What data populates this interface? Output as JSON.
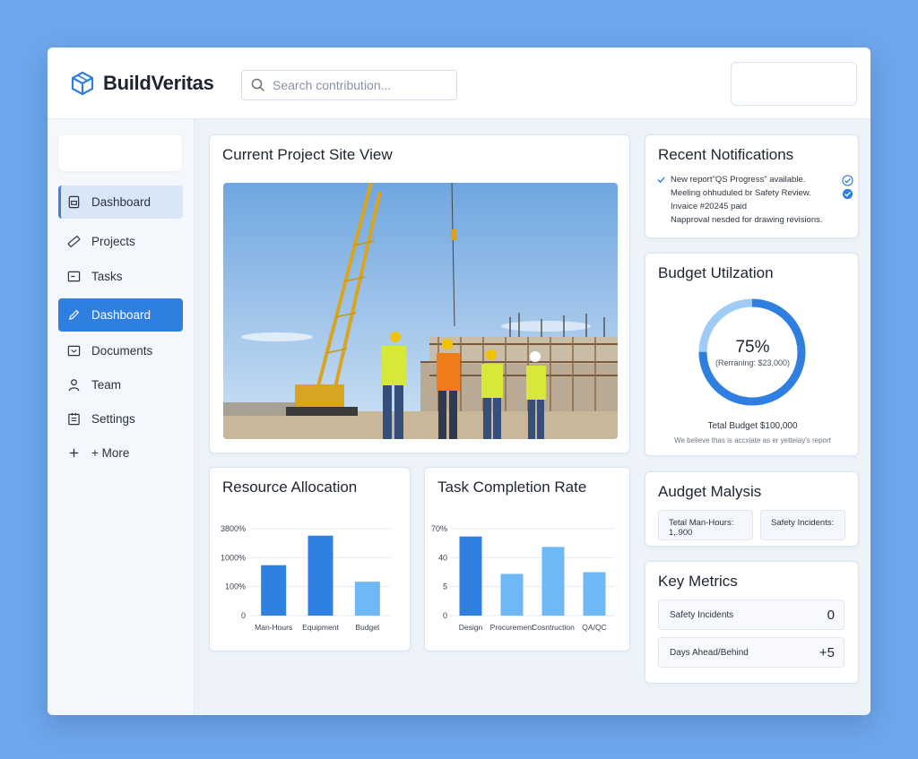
{
  "app": {
    "name": "BuildVeritas"
  },
  "search": {
    "placeholder": "Search contribution..."
  },
  "sidebar": {
    "items": [
      {
        "label": "Dashboard",
        "icon": "dashboard-icon"
      },
      {
        "label": "Projects",
        "icon": "ruler-icon"
      },
      {
        "label": "Tasks",
        "icon": "tasks-icon"
      },
      {
        "label": "Dashboard",
        "icon": "pencil-icon"
      },
      {
        "label": "Documents",
        "icon": "documents-icon"
      },
      {
        "label": "Team",
        "icon": "user-icon"
      },
      {
        "label": "Settings",
        "icon": "settings-icon"
      },
      {
        "label": "+ More",
        "icon": "plus-icon"
      }
    ]
  },
  "site_view": {
    "title": "Current Project Site View"
  },
  "notifications": {
    "title": "Recent Notifications",
    "items": [
      {
        "text": "New report\"QS Progress\" available.",
        "lead": "✓",
        "tail": "check-circle"
      },
      {
        "text": "Meeling ohhuduled br Safety Review.",
        "lead": "",
        "tail": "check-circle"
      },
      {
        "text": "Invaice #20245 paid",
        "lead": "",
        "tail": ""
      },
      {
        "text": "Napproval nesded for drawing revisions.",
        "lead": "",
        "tail": ""
      }
    ]
  },
  "budget": {
    "title": "Budget Utilzation",
    "percent_label": "75%",
    "percent_value": 75,
    "remaining": "(Rerraning: $23,000)",
    "total": "Tetal Budget  $100,000",
    "note": "We believe thas is accxiate as er yetteiay's report"
  },
  "resource": {
    "title": "Resource Allocation"
  },
  "task_rate": {
    "title": "Task Completion Rate"
  },
  "malysis": {
    "title": "Audget Malysis",
    "box1": "Tetal Man-Hours: 1,.900",
    "box2": "Safety Incidents:"
  },
  "metrics": {
    "title": "Key Metrics",
    "rows": [
      {
        "label": "Safety Incidents",
        "value": "0"
      },
      {
        "label": "Days Ahead/Behind",
        "value": "+5"
      }
    ]
  },
  "colors": {
    "accent": "#2f7fe0",
    "bar_dark": "#2f80e0",
    "bar_light": "#6db8f5",
    "page_bg": "#6fa7ec"
  },
  "chart_data": [
    {
      "type": "bar",
      "title": "Resource Allocation",
      "categories": [
        "Man-Hours",
        "Equipment",
        "Budget"
      ],
      "values": [
        58,
        92,
        39
      ],
      "y_tick_labels": [
        "3800%",
        "1000%",
        "100%",
        "0"
      ],
      "ylim": [
        0,
        100
      ],
      "bar_colors": [
        "#2f80e0",
        "#2f80e0",
        "#6db8f5"
      ],
      "grid": true
    },
    {
      "type": "bar",
      "title": "Task Completion Rate",
      "categories": [
        "Design",
        "Procurement",
        "Cosntruction",
        "QA/QC"
      ],
      "values": [
        91,
        48,
        79,
        50
      ],
      "y_tick_labels": [
        "70%",
        "40",
        "5",
        "0"
      ],
      "ylim": [
        0,
        100
      ],
      "bar_colors": [
        "#2f80e0",
        "#6db8f5",
        "#6db8f5",
        "#6db8f5"
      ],
      "grid": true
    }
  ]
}
